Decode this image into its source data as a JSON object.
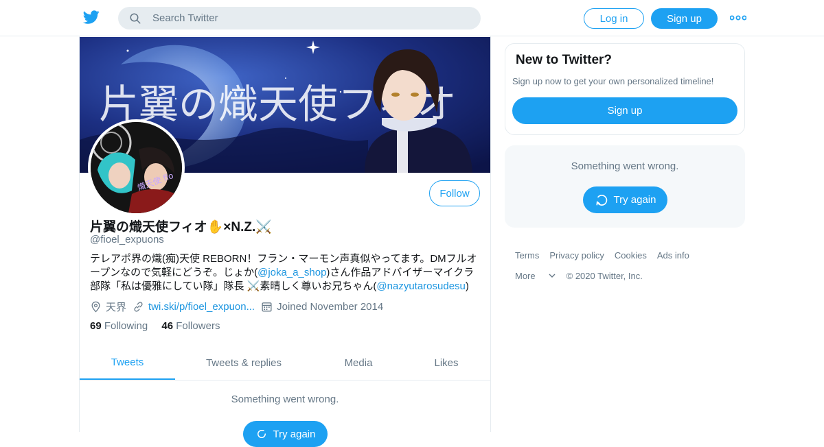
{
  "header": {
    "search_placeholder": "Search Twitter",
    "login_label": "Log in",
    "signup_label": "Sign up",
    "logo": "twitter-bird-icon",
    "more": "more-dots-icon"
  },
  "profile": {
    "name": "片翼の熾天使フィオ✋×N.Z.⚔️",
    "handle": "@fioel_expuons",
    "follow_label": "Follow",
    "bio": {
      "t1": "テレアポ界の熾(痴)天使 REBORN！フラン・マーモン声真似やってます。DMフルオープンなので気軽にどうぞ。じょか(",
      "link1": "@joka_a_shop",
      "t2": ")さん作品アドバイザーマイクラ部隊「私は優雅にしてい隊」隊長 ⚔️素晴しく尊いお兄ちゃん(",
      "link2": "@nazyutarosudesu",
      "t3": ")"
    },
    "location": "天界",
    "website": "twi.ski/p/fioel_expuon...",
    "joined": "Joined November 2014",
    "following_count": "69",
    "following_label": "Following",
    "followers_count": "46",
    "followers_label": "Followers",
    "banner_text": "片翼の熾天使フィオ",
    "avatar_text": "熾天使 fio"
  },
  "tabs": [
    "Tweets",
    "Tweets & replies",
    "Media",
    "Likes"
  ],
  "timeline": {
    "error": "Something went wrong.",
    "retry": "Try again"
  },
  "sidebar": {
    "new_title": "New to Twitter?",
    "new_desc": "Sign up now to get your own personalized timeline!",
    "signup_label": "Sign up",
    "error": "Something went wrong.",
    "retry": "Try again"
  },
  "footer": {
    "links": [
      "Terms",
      "Privacy policy",
      "Cookies",
      "Ads info"
    ],
    "more": "More",
    "copyright": "© 2020 Twitter, Inc."
  },
  "colors": {
    "accent": "#1da1f2",
    "text_secondary": "#657786",
    "border": "#e6ecf0"
  }
}
